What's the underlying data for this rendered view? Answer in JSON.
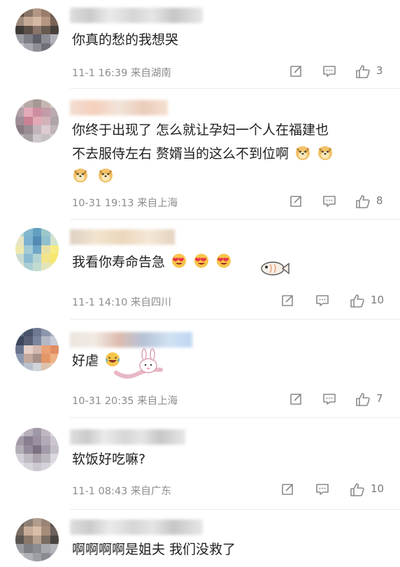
{
  "comments": [
    {
      "text_lines": [
        "你真的愁的我想哭"
      ],
      "meta": "11-1 16:39 来自湖南",
      "likes": "3",
      "avatar_colors": [
        "#5a4a3e",
        "#8a7464",
        "#b49684",
        "#9a7c6a",
        "#6e5a4c",
        "#a08a7a",
        "#c8aa94",
        "#d8b8a2",
        "#b6967e",
        "#7c6454",
        "#3e3a36",
        "#5c5046",
        "#8a7466",
        "#6a5a4e",
        "#48403a",
        "#9a9aa4",
        "#7e7e88",
        "#5e5e6a",
        "#8c8c96",
        "#b0b0ba",
        "#c4c4cc",
        "#a8a8b2",
        "#8e8e98",
        "#70707a",
        "#9c9ca6"
      ]
    },
    {
      "text_lines": [
        "你终于出现了 怎么就让孕妇一个人在福建也",
        "不去服侍左右 赘婿当的这么不到位啊"
      ],
      "meta": "10-31 19:13 来自上海",
      "likes": "8",
      "avatar_colors": [
        "#cfc4c0",
        "#b8aaa4",
        "#a89894",
        "#c6b6b0",
        "#d8ccc8",
        "#b4a0a6",
        "#e8a8b8",
        "#d48ca0",
        "#c89aa8",
        "#bcaab0",
        "#a08c98",
        "#cf7f94",
        "#e6a8b4",
        "#d6b0b8",
        "#b0a4a8",
        "#8a7c86",
        "#9a8c96",
        "#c4b4bc",
        "#dccad0",
        "#c0b4b8",
        "#b8b0b4",
        "#a8a0a4",
        "#d0c8cc",
        "#c8c0c4",
        "#d8d2d4"
      ]
    },
    {
      "text_lines": [
        "我看你寿命告急"
      ],
      "meta": "11-1 14:10 来自四川",
      "likes": "10",
      "avatar_colors": [
        "#a8d4d8",
        "#7cb8d0",
        "#5ea0c4",
        "#98c8cc",
        "#c8e0d8",
        "#e8e4c0",
        "#78b4d4",
        "#4e8cb8",
        "#8cc0d0",
        "#d0e4c8",
        "#f0e8a8",
        "#a0ccd8",
        "#6aa8cc",
        "#e8e0a0",
        "#f8ec78",
        "#c8dcd0",
        "#88bcd4",
        "#b0d4d4",
        "#f4e480",
        "#f8e860",
        "#d8e4c8",
        "#a8d0d4",
        "#c0dcd0",
        "#e4e4b8",
        "#f0e898"
      ]
    },
    {
      "text_lines": [
        "好虐"
      ],
      "meta": "10-31 20:35 来自上海",
      "likes": "7",
      "avatar_colors": [
        "#5e6a84",
        "#48546e",
        "#6e7894",
        "#8a96b0",
        "#a4aec4",
        "#3c4660",
        "#56607a",
        "#7a86a0",
        "#b4b8c8",
        "#c8ccd8",
        "#6a7490",
        "#e8cfc6",
        "#d8b8ae",
        "#f0a070",
        "#e88c5c",
        "#8c98b4",
        "#c4a89c",
        "#a89088",
        "#ec9460",
        "#f4b080",
        "#a0aac0",
        "#b8c0d0",
        "#d0d4dc",
        "#e0c0a8",
        "#f0c8a8"
      ]
    },
    {
      "text_lines": [
        "软饭好吃嘛?"
      ],
      "meta": "11-1 08:43 来自广东",
      "likes": "10",
      "avatar_colors": [
        "#d0ccd4",
        "#b8b0bc",
        "#a098a8",
        "#c0b8c4",
        "#d8d4dc",
        "#a49aaa",
        "#8a7e90",
        "#9c90a2",
        "#b4aab8",
        "#ccc6d0",
        "#b4aeb8",
        "#968c9c",
        "#7c7082",
        "#a29aa8",
        "#c4beca",
        "#d4d0d8",
        "#c0bac4",
        "#aca4b0",
        "#bcb6c0",
        "#dcd8e0",
        "#e4e0e6",
        "#d8d4dc",
        "#ccc8d0",
        "#d6d2da",
        "#e6e2e8"
      ]
    },
    {
      "text_lines": [
        "啊啊啊啊是姐夫 我们没救了"
      ],
      "meta": "",
      "likes": "",
      "avatar_colors": [
        "#6a5e56",
        "#8e7e72",
        "#b49c8a",
        "#9c8474",
        "#5c524c",
        "#7e6e62",
        "#c8ac96",
        "#dcbca4",
        "#a88c78",
        "#6e625a",
        "#5a5450",
        "#8a7868",
        "#b8a08c",
        "#7c6c60",
        "#4a4440",
        "#9a9aa2",
        "#7e7e86",
        "#8c8c94",
        "#a8a8b0",
        "#b4b4bc",
        "#c4c4ca",
        "#b0b0b8",
        "#9e9ea6",
        "#8a8a92",
        "#a4a4ac"
      ]
    }
  ],
  "icon_names": [
    "repost-icon",
    "comment-icon",
    "like-icon"
  ],
  "emoji_names": [
    "doge-emoji",
    "heart-eyes-emoji",
    "laugh-cry-emoji"
  ]
}
